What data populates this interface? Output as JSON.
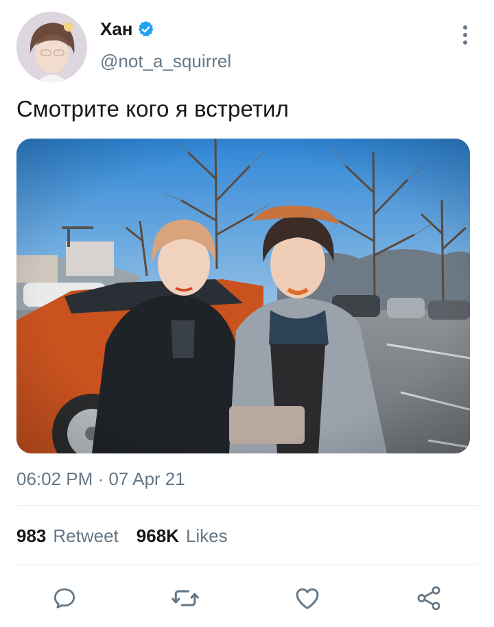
{
  "user": {
    "display_name": "Хан",
    "handle": "@not_a_squirrel",
    "verified": true
  },
  "tweet": {
    "text": "Смотрите кого я встретил",
    "timestamp": "06:02 PM · 07 Apr 21"
  },
  "stats": {
    "retweets_count": "983",
    "retweets_label": "Retweet",
    "likes_count": "968K",
    "likes_label": "Likes"
  },
  "actions": {
    "reply_icon": "reply-icon",
    "retweet_icon": "retweet-icon",
    "like_icon": "heart-icon",
    "share_icon": "share-icon"
  },
  "colors": {
    "text_primary": "#14171a",
    "text_secondary": "#657786",
    "verified_blue": "#1da1f2",
    "divider": "#e1e8ed"
  }
}
